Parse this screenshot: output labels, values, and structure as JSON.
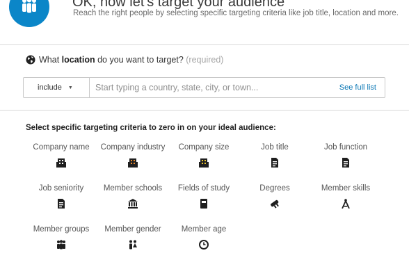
{
  "header": {
    "title": "OK, now let's target your audience",
    "subtitle": "Reach the right people by selecting specific targeting criteria like job title, location and more."
  },
  "location": {
    "prefix": "What ",
    "keyword": "location",
    "suffix": " do you want to target? ",
    "required": "(required)",
    "include_label": "include",
    "placeholder": "Start typing a country, state, city, or town...",
    "see_full_list": "See full list"
  },
  "criteria": {
    "heading": "Select specific targeting criteria to zero in on your ideal audience:",
    "items": [
      {
        "label": "Company name",
        "icon": "building-icon"
      },
      {
        "label": "Company industry",
        "icon": "building-color-icon"
      },
      {
        "label": "Company size",
        "icon": "building-color-icon"
      },
      {
        "label": "Job title",
        "icon": "document-icon"
      },
      {
        "label": "Job function",
        "icon": "document-icon"
      },
      {
        "label": "Job seniority",
        "icon": "document-icon"
      },
      {
        "label": "Member schools",
        "icon": "school-icon"
      },
      {
        "label": "Fields of study",
        "icon": "book-icon"
      },
      {
        "label": "Degrees",
        "icon": "diploma-icon"
      },
      {
        "label": "Member skills",
        "icon": "compass-icon"
      },
      {
        "label": "Member groups",
        "icon": "group-icon"
      },
      {
        "label": "Member gender",
        "icon": "gender-icon"
      },
      {
        "label": "Member age",
        "icon": "clock-icon"
      }
    ]
  },
  "colors": {
    "accent": "#0b86c8",
    "link": "#0a77b5",
    "icon_dark": "#1f1f1f",
    "icon_orange": "#e8872a"
  }
}
